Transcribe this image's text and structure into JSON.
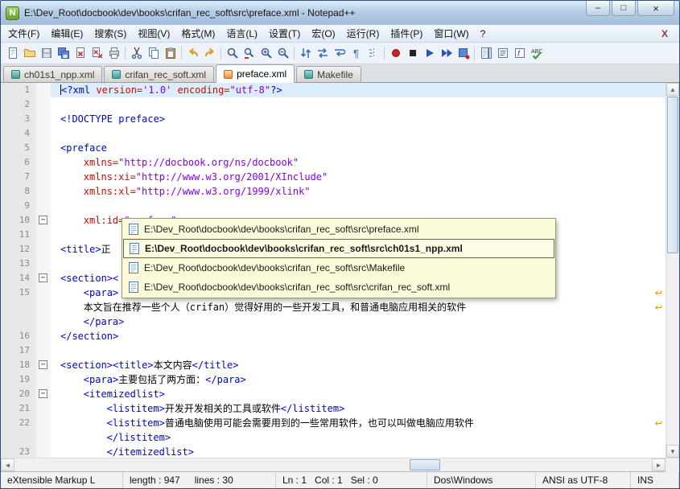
{
  "window": {
    "title": "E:\\Dev_Root\\docbook\\dev\\books\\crifan_rec_soft\\src\\preface.xml - Notepad++"
  },
  "icons": {
    "notepadpp-logo-icon": "N",
    "minimize-icon": "–",
    "maximize-icon": "□",
    "close-icon": "×",
    "menubar-close-icon": "X",
    "fold-collapse-icon": "−",
    "wrap-icon": "↩",
    "scroll-up-icon": "▲",
    "scroll-down-icon": "▼",
    "scroll-left-icon": "◄",
    "scroll-right-icon": "►"
  },
  "menu": {
    "items": [
      "文件(F)",
      "编辑(E)",
      "搜索(S)",
      "视图(V)",
      "格式(M)",
      "语言(L)",
      "设置(T)",
      "宏(O)",
      "运行(R)",
      "插件(P)",
      "窗口(W)",
      "?"
    ]
  },
  "toolbar": {
    "items": [
      "new-document-icon",
      "open-folder-icon",
      "save-icon",
      "save-all-icon",
      "close-document-icon",
      "close-all-icon",
      "print-icon",
      "cut-icon",
      "copy-icon",
      "paste-icon",
      "undo-icon",
      "redo-icon",
      "find-icon",
      "replace-icon",
      "zoom-in-icon",
      "zoom-out-icon",
      "sync-vertical-icon",
      "sync-horizontal-icon",
      "word-wrap-icon",
      "show-all-characters-icon",
      "indent-guide-icon",
      "macro-record-icon",
      "macro-stop-icon",
      "macro-play-icon",
      "macro-run-multiple-icon",
      "macro-save-icon",
      "document-map-icon",
      "document-list-icon",
      "function-list-icon",
      "spell-check-icon"
    ]
  },
  "tabs": [
    {
      "label": "ch01s1_npp.xml",
      "active": false
    },
    {
      "label": "crifan_rec_soft.xml",
      "active": false
    },
    {
      "label": "preface.xml",
      "active": true
    },
    {
      "label": "Makefile",
      "active": false
    }
  ],
  "popup": {
    "items": [
      {
        "text": "E:\\Dev_Root\\docbook\\dev\\books\\crifan_rec_soft\\src\\preface.xml",
        "selected": false
      },
      {
        "text": "E:\\Dev_Root\\docbook\\dev\\books\\crifan_rec_soft\\src\\ch01s1_npp.xml",
        "selected": true
      },
      {
        "text": "E:\\Dev_Root\\docbook\\dev\\books\\crifan_rec_soft\\src\\Makefile",
        "selected": false
      },
      {
        "text": "E:\\Dev_Root\\docbook\\dev\\books\\crifan_rec_soft\\src\\crifan_rec_soft.xml",
        "selected": false
      }
    ]
  },
  "editor": {
    "colors": {
      "tag": "#0000e0",
      "attribute": "#e00000",
      "value": "#8000ff",
      "text": "#000000",
      "current_line_bg": "#dcecfa"
    },
    "rows": [
      {
        "num": "1",
        "hl": true,
        "caret": true,
        "indent": 0,
        "tokens": [
          [
            "<?xml",
            "tag"
          ],
          [
            " version=",
            "attr"
          ],
          [
            "'1.0'",
            "val"
          ],
          [
            " encoding=",
            "attr"
          ],
          [
            "\"utf-8\"",
            "val"
          ],
          [
            "?>",
            "tag"
          ]
        ]
      },
      {
        "num": "2",
        "tokens": []
      },
      {
        "num": "3",
        "tokens": [
          [
            "<!DOCTYPE preface>",
            "tag"
          ]
        ]
      },
      {
        "num": "4",
        "tokens": []
      },
      {
        "num": "5",
        "tokens": [
          [
            "<preface",
            "tag"
          ]
        ]
      },
      {
        "num": "6",
        "indent": 4,
        "tokens": [
          [
            "xmlns=",
            "attr"
          ],
          [
            "\"http://docbook.org/ns/docbook\"",
            "val"
          ]
        ]
      },
      {
        "num": "7",
        "indent": 4,
        "tokens": [
          [
            "xmlns:xi=",
            "attr"
          ],
          [
            "\"http://www.w3.org/2001/XInclude\"",
            "val"
          ]
        ]
      },
      {
        "num": "8",
        "indent": 4,
        "tokens": [
          [
            "xmlns:xl=",
            "attr"
          ],
          [
            "\"http://www.w3.org/1999/xlink\"",
            "val"
          ]
        ]
      },
      {
        "num": "9",
        "tokens": []
      },
      {
        "num": "10",
        "fold": true,
        "indent": 4,
        "tokens": [
          [
            "xml:id=",
            "attr"
          ],
          [
            "\"preface\"",
            "val"
          ],
          [
            ">",
            "tag"
          ]
        ]
      },
      {
        "num": "11",
        "tokens": []
      },
      {
        "num": "12",
        "tokens": [
          [
            "<title>",
            "tag"
          ],
          [
            "正",
            "text"
          ]
        ]
      },
      {
        "num": "13",
        "tokens": []
      },
      {
        "num": "14",
        "fold": true,
        "tokens": [
          [
            "<section><",
            "tag"
          ]
        ]
      },
      {
        "num": "15",
        "indent": 4,
        "wrap": true,
        "tokens": [
          [
            "<para>",
            "tag"
          ]
        ]
      },
      {
        "num": "",
        "indent": 4,
        "wrap": true,
        "tokens": [
          [
            "本文旨在推荐一些个人（crifan）觉得好用的一些开发工具，和普通电脑应用相关的软件",
            "text"
          ]
        ]
      },
      {
        "num": "",
        "indent": 4,
        "tokens": [
          [
            "</para>",
            "tag"
          ]
        ]
      },
      {
        "num": "16",
        "tokens": [
          [
            "</section>",
            "tag"
          ]
        ]
      },
      {
        "num": "17",
        "tokens": []
      },
      {
        "num": "18",
        "fold": true,
        "tokens": [
          [
            "<section>",
            "tag"
          ],
          [
            "<title>",
            "tag"
          ],
          [
            "本文内容",
            "text"
          ],
          [
            "</title>",
            "tag"
          ]
        ]
      },
      {
        "num": "19",
        "indent": 4,
        "tokens": [
          [
            "<para>",
            "tag"
          ],
          [
            "主要包括了两方面：",
            "text"
          ],
          [
            "</para>",
            "tag"
          ]
        ]
      },
      {
        "num": "20",
        "fold": true,
        "indent": 4,
        "tokens": [
          [
            "<itemizedlist>",
            "tag"
          ]
        ]
      },
      {
        "num": "21",
        "indent": 8,
        "tokens": [
          [
            "<listitem>",
            "tag"
          ],
          [
            "开发开发相关的工具或软件",
            "text"
          ],
          [
            "</listitem>",
            "tag"
          ]
        ]
      },
      {
        "num": "22",
        "indent": 8,
        "wrap": true,
        "tokens": [
          [
            "<listitem>",
            "tag"
          ],
          [
            "普通电脑使用可能会需要用到的一些常用软件，也可以叫做电脑应用软件",
            "text"
          ]
        ]
      },
      {
        "num": "",
        "indent": 8,
        "tokens": [
          [
            "</listitem>",
            "tag"
          ]
        ]
      },
      {
        "num": "23",
        "indent": 8,
        "tokens": [
          [
            "</itemizedlist>",
            "tag"
          ]
        ]
      }
    ]
  },
  "statusbar": {
    "doc_type": "eXtensible Markup L",
    "length": "length : 947",
    "lines": "lines : 30",
    "cursor": "Ln : 1   Col : 1   Sel : 0",
    "eol": "Dos\\Windows",
    "encoding": "ANSI as UTF-8",
    "mode": "INS"
  }
}
